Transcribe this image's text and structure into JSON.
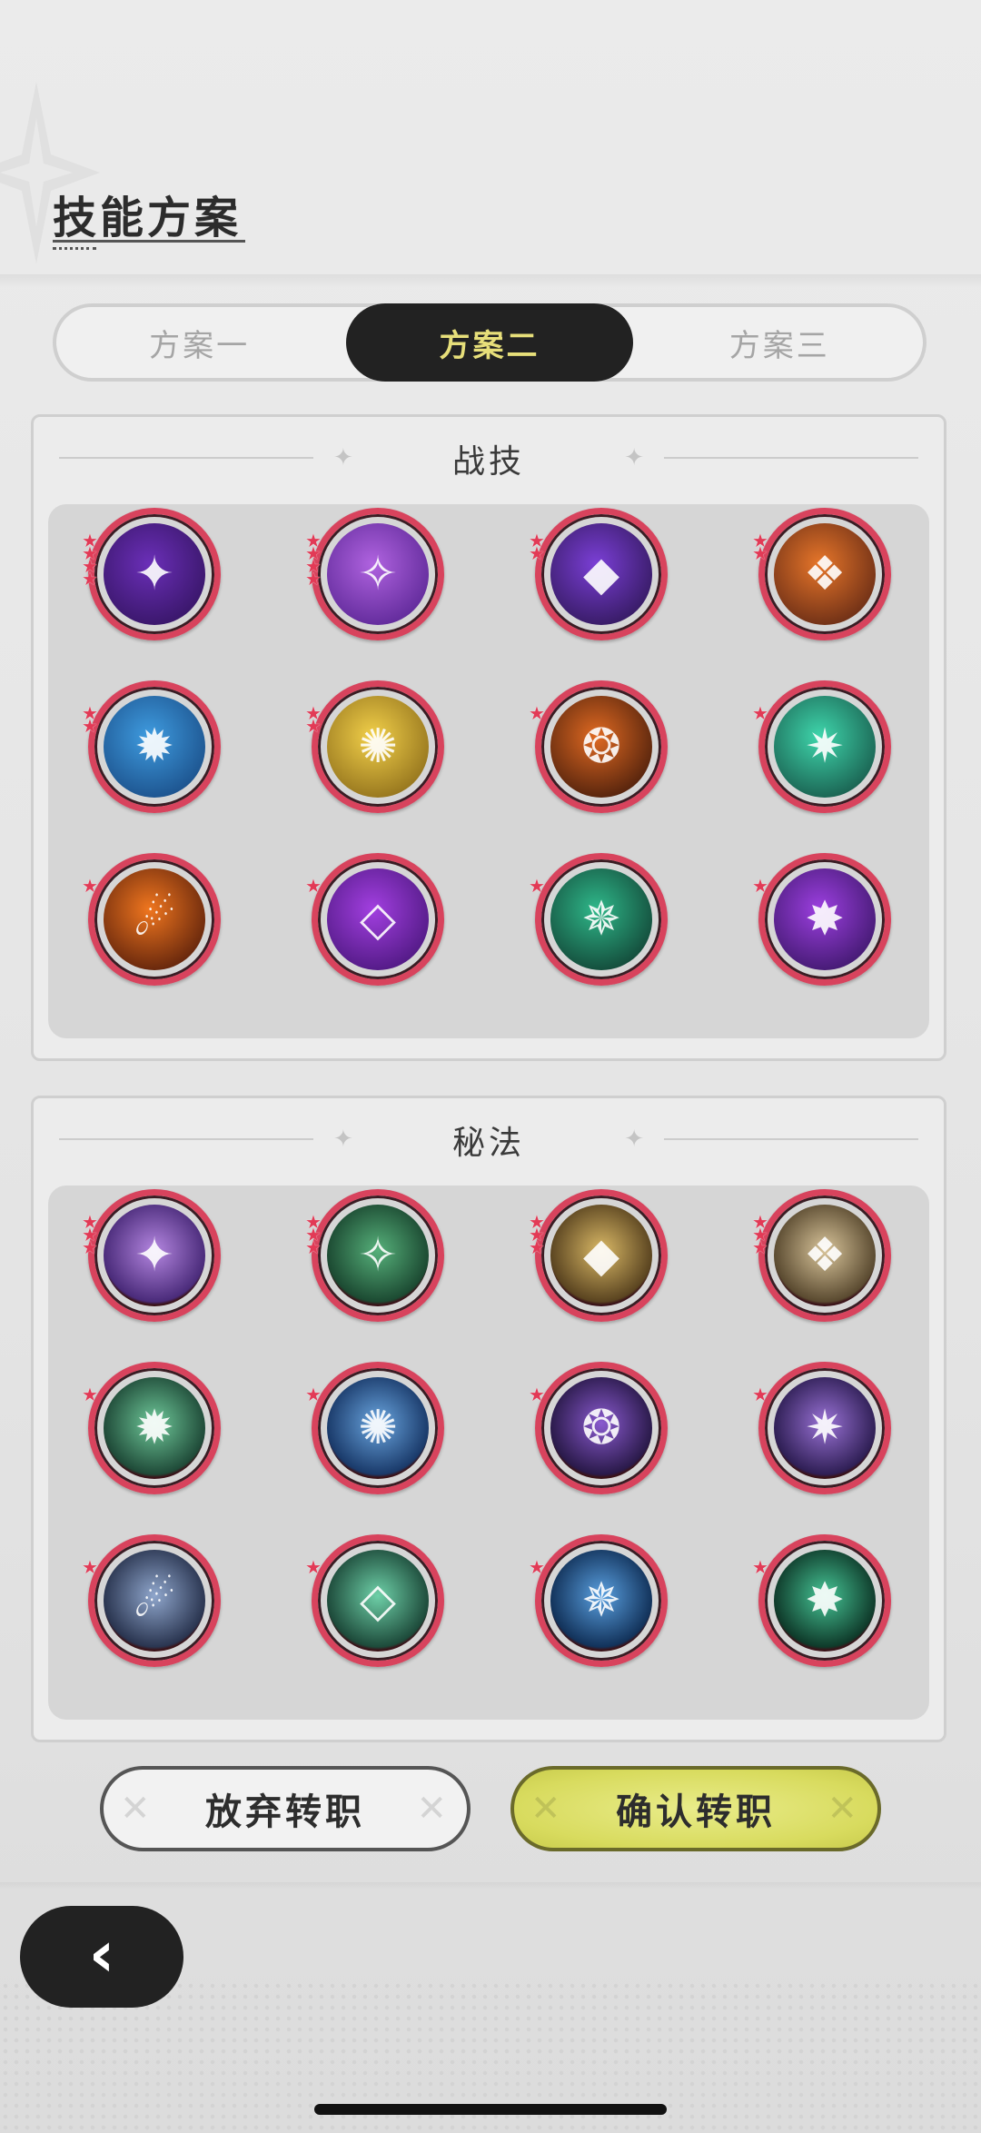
{
  "page": {
    "title": "技能方案"
  },
  "tabs": [
    {
      "label": "方案一",
      "active": false
    },
    {
      "label": "方案二",
      "active": true
    },
    {
      "label": "方案三",
      "active": false
    }
  ],
  "sections": {
    "combat": {
      "title": "战技"
    },
    "secret": {
      "title": "秘法"
    }
  },
  "combat_skills": [
    {
      "icon": "purple-star-burst-icon",
      "stars": 4,
      "colors": [
        "#6b2fb8",
        "#2a0f52"
      ]
    },
    {
      "icon": "purple-robot-icon",
      "stars": 4,
      "colors": [
        "#b063e0",
        "#4a1a86"
      ]
    },
    {
      "icon": "purple-orb-swirl-icon",
      "stars": 2,
      "colors": [
        "#7b3fd6",
        "#221042"
      ]
    },
    {
      "icon": "fire-wolf-icon",
      "stars": 2,
      "colors": [
        "#e7762a",
        "#4a1a10"
      ]
    },
    {
      "icon": "blue-spirit-creature-icon",
      "stars": 2,
      "colors": [
        "#3f9ce0",
        "#123d75"
      ]
    },
    {
      "icon": "golden-sparkle-icon",
      "stars": 2,
      "colors": [
        "#f2d04a",
        "#7a5a10"
      ]
    },
    {
      "icon": "fire-spiral-icon",
      "stars": 1,
      "colors": [
        "#e06a22",
        "#2a0d06"
      ]
    },
    {
      "icon": "green-claw-slash-icon",
      "stars": 1,
      "colors": [
        "#3fd6ac",
        "#0f3f36"
      ]
    },
    {
      "icon": "fireball-icon",
      "stars": 1,
      "colors": [
        "#f0761f",
        "#3a0d06"
      ]
    },
    {
      "icon": "purple-diamond-icon",
      "stars": 1,
      "colors": [
        "#a23fe0",
        "#3a0f6a"
      ]
    },
    {
      "icon": "green-meditating-figure-icon",
      "stars": 1,
      "colors": [
        "#2fb88a",
        "#0b2a22"
      ]
    },
    {
      "icon": "purple-eye-vortex-icon",
      "stars": 1,
      "colors": [
        "#9c3fe0",
        "#2a0f52"
      ]
    }
  ],
  "secret_skills": [
    {
      "icon": "purple-rune-stone-icon",
      "stars": 3,
      "colors": [
        "#b486e0",
        "#4a2b7a"
      ]
    },
    {
      "icon": "green-winged-emblem-icon",
      "stars": 3,
      "colors": [
        "#56b07a",
        "#1c4a32"
      ]
    },
    {
      "icon": "golden-figure-icon",
      "stars": 3,
      "colors": [
        "#d9b866",
        "#5a4420"
      ]
    },
    {
      "icon": "bronze-arrow-up-icon",
      "stars": 3,
      "colors": [
        "#d8c49a",
        "#5a4a30"
      ]
    },
    {
      "icon": "green-shield-icon",
      "stars": 1,
      "colors": [
        "#6fc99a",
        "#1f4a38"
      ]
    },
    {
      "icon": "blue-crystal-icon",
      "stars": 1,
      "colors": [
        "#6aa6e0",
        "#1a3a6a"
      ]
    },
    {
      "icon": "purple-figure-heart-icon",
      "stars": 1,
      "colors": [
        "#8a5acf",
        "#2a1a4a"
      ]
    },
    {
      "icon": "purple-temple-icon",
      "stars": 1,
      "colors": [
        "#9a72d6",
        "#2f1f55"
      ]
    },
    {
      "icon": "blue-armor-icon",
      "stars": 1,
      "colors": [
        "#8fa6cc",
        "#2a3550"
      ]
    },
    {
      "icon": "green-swirl-icon",
      "stars": 1,
      "colors": [
        "#6ed0a8",
        "#1d4a3a"
      ]
    },
    {
      "icon": "blue-praying-figure-icon",
      "stars": 1,
      "colors": [
        "#5aa0e0",
        "#12325a"
      ]
    },
    {
      "icon": "green-praying-figure-icon",
      "stars": 1,
      "colors": [
        "#46c596",
        "#0f3a2a"
      ]
    }
  ],
  "buttons": {
    "abandon": "放弃转职",
    "confirm": "确认转职"
  },
  "back": {
    "icon": "chevron-left-icon"
  }
}
